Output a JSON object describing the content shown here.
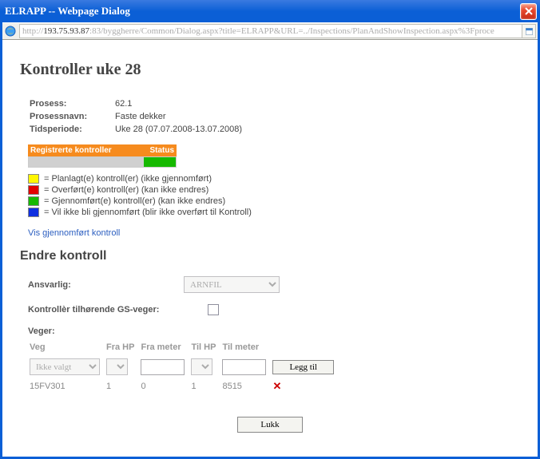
{
  "window": {
    "title": "ELRAPP -- Webpage Dialog"
  },
  "address": {
    "prefix": "http://",
    "host": "193.75.93.87",
    "rest": ":83/byggherre/Common/Dialog.aspx?title=ELRAPP&URL=../Inspections/PlanAndShowInspection.aspx%3Fproce"
  },
  "page": {
    "heading": "Kontroller uke 28",
    "info": {
      "prosess_label": "Prosess:",
      "prosess_value": "62.1",
      "prosessnavn_label": "Prosessnavn:",
      "prosessnavn_value": "Faste dekker",
      "tidsperiode_label": "Tidsperiode:",
      "tidsperiode_value": "Uke 28 (07.07.2008-13.07.2008)"
    },
    "status_bar": {
      "title_left": "Registrerte kontroller",
      "title_right": "Status"
    },
    "legend": {
      "yellow": "= Planlagt(e) kontroll(er) (ikke gjennomført)",
      "red": "= Overført(e) kontroll(er) (kan ikke endres)",
      "green": "= Gjennomført(e) kontroll(er) (kan ikke endres)",
      "blue": "= Vil ikke bli gjennomført (blir ikke overført til Kontroll)"
    },
    "link_vis": "Vis gjennomført kontroll",
    "endre_heading": "Endre kontroll",
    "form": {
      "ansvarlig_label": "Ansvarlig:",
      "ansvarlig_value": "ARNFIL",
      "gs_label": "Kontrollèr tilhørende GS-veger:",
      "veger_label": "Veger:"
    },
    "veg_table": {
      "headers": {
        "veg": "Veg",
        "frahp": "Fra HP",
        "frameter": "Fra meter",
        "tilhp": "Til HP",
        "tilmeter": "Til meter"
      },
      "input_row": {
        "ikke_valgt": "Ikke valgt",
        "frameter": "",
        "tilmeter": "",
        "leggtil": "Legg til"
      },
      "data_row": {
        "veg": "15FV301",
        "frahp": "1",
        "frameter": "0",
        "tilhp": "1",
        "tilmeter": "8515"
      }
    },
    "lukk": "Lukk"
  }
}
